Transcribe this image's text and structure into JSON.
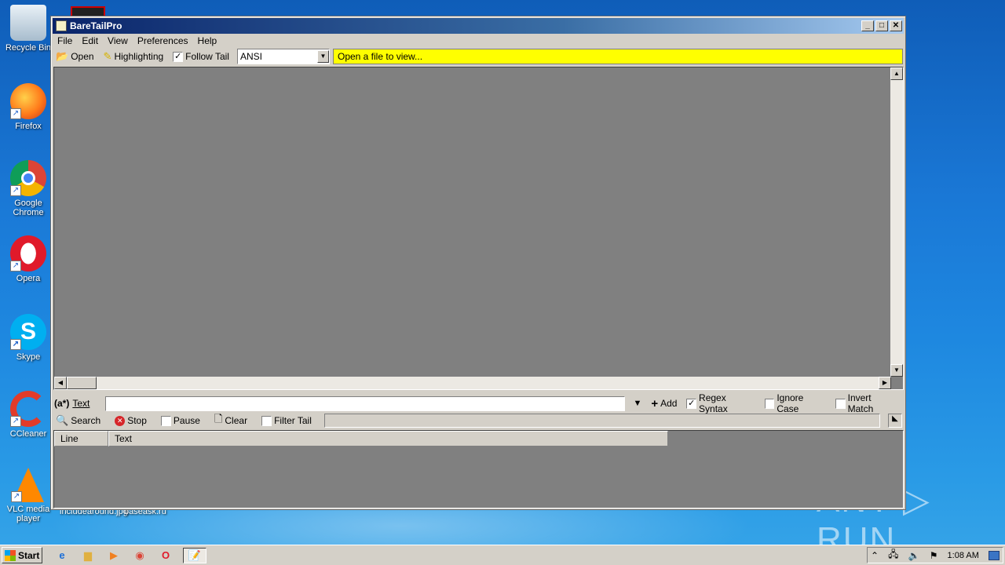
{
  "desktop": {
    "icons": [
      {
        "label": "Recycle Bin",
        "glyph": "🗑",
        "icon": "recycle-bin-icon"
      },
      {
        "label": "Firefox",
        "glyph": "🦊",
        "icon": "firefox-icon"
      },
      {
        "label": "Google Chrome",
        "glyph": "◉",
        "icon": "chrome-icon"
      },
      {
        "label": "Opera",
        "glyph": "O",
        "icon": "opera-icon"
      },
      {
        "label": "Skype",
        "glyph": "S",
        "icon": "skype-icon"
      },
      {
        "label": "CCleaner",
        "glyph": "C",
        "icon": "ccleaner-icon"
      },
      {
        "label": "VLC media player",
        "glyph": "▲",
        "icon": "vlc-icon"
      }
    ],
    "behind_labels": [
      "includearound.jpg",
      "baseask.ru"
    ],
    "watermark": "ANY ▷ RUN"
  },
  "window": {
    "title": "BareTailPro",
    "menu": [
      "File",
      "Edit",
      "View",
      "Preferences",
      "Help"
    ],
    "toolbar": {
      "open": "Open",
      "highlighting": "Highlighting",
      "follow_tail": "Follow Tail",
      "follow_tail_checked": "✓",
      "encoding": "ANSI",
      "status": "Open a file to view..."
    },
    "search": {
      "mode_label": "(a*)",
      "text_label": "Text",
      "text_value": "",
      "add": "Add",
      "regex_syntax": "Regex Syntax",
      "regex_checked": "✓",
      "ignore_case": "Ignore Case",
      "invert_match": "Invert Match"
    },
    "search_controls": {
      "search": "Search",
      "stop": "Stop",
      "pause": "Pause",
      "clear": "Clear",
      "filter_tail": "Filter Tail"
    },
    "results": {
      "columns": [
        "Line",
        "Text"
      ]
    }
  },
  "taskbar": {
    "start": "Start",
    "clock": "1:08 AM"
  }
}
